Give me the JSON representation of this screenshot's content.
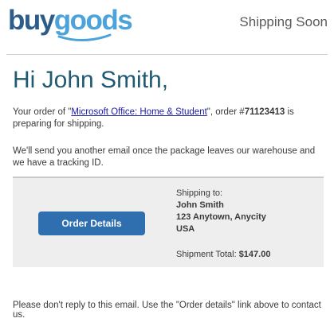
{
  "header": {
    "logo_part1": "buy",
    "logo_part2": "goods",
    "status": "Shipping Soon"
  },
  "greeting": "Hi John Smith,",
  "message": {
    "p1_prefix": "Your order of \"",
    "product_link": "Microsoft Office: Home & Student",
    "p1_mid": "\", order #",
    "order_number": "71123413",
    "p1_suffix": " is preparing for shipping.",
    "p2": "We'll send you another email once the package leaves our warehouse and we have a tracking ID."
  },
  "order_panel": {
    "button_label": "Order Details",
    "shipping_to_label": "Shipping to:",
    "address": [
      "John Smith",
      "123 Anytown, Anycity",
      "USA"
    ],
    "total_label": "Shipment Total:",
    "total_value": "$147.00"
  },
  "footer": "Please don't reply to this email. Use the \"Order details\" link above to contact us.",
  "colors": {
    "brand_dark": "#2b5c8a",
    "brand_light": "#4ba3d9",
    "button": "#2f6fb0",
    "greeting": "#1f5a72"
  }
}
